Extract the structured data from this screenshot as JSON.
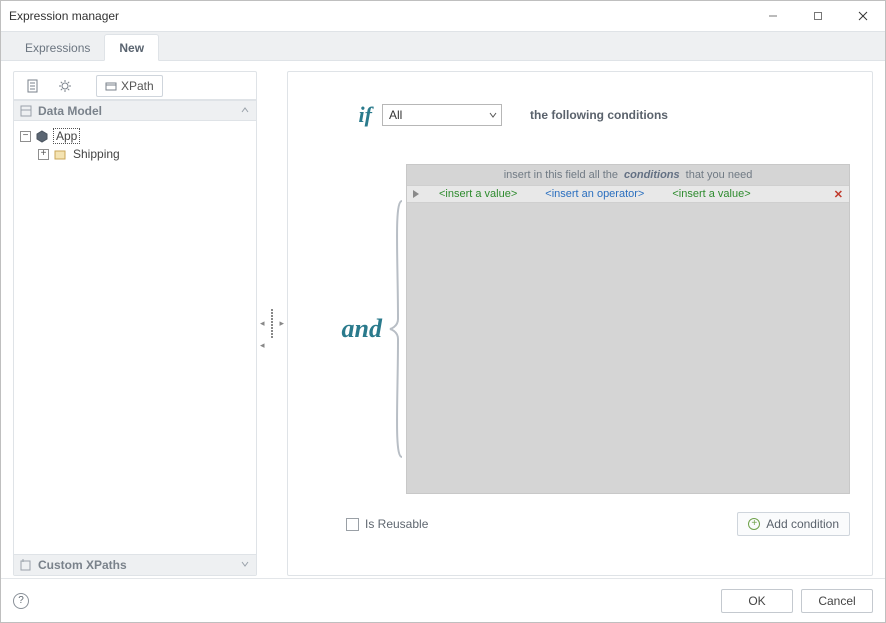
{
  "window": {
    "title": "Expression manager"
  },
  "tabs": {
    "expressions": "Expressions",
    "new": "New"
  },
  "left": {
    "xpath_tab": "XPath",
    "data_model_header": "Data Model",
    "custom_xpaths_header": "Custom XPaths",
    "tree": {
      "root": "App",
      "child1": "Shipping"
    }
  },
  "editor": {
    "kw_if": "if",
    "kw_and": "and",
    "dropdown": {
      "value": "All"
    },
    "following_text": "the following conditions",
    "hint_pre": "insert in this field all the",
    "hint_em": "conditions",
    "hint_post": "that you need",
    "placeholders": {
      "value_left": "<insert a value>",
      "operator": "<insert an operator>",
      "value_right": "<insert a value>"
    },
    "is_reusable_label": "Is Reusable",
    "add_condition_label": "Add condition"
  },
  "footer": {
    "ok": "OK",
    "cancel": "Cancel"
  },
  "chart_data": null
}
